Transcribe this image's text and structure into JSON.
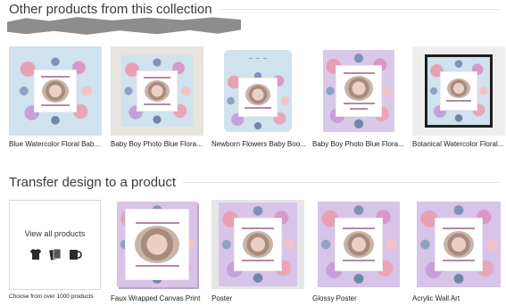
{
  "section1": {
    "title": "Other products from this collection"
  },
  "collection": [
    {
      "caption": "Blue Watercolor Floral Bab...",
      "bg": "#cfe2ee"
    },
    {
      "caption": "Baby Boy Photo Blue Flora...",
      "bg": "#e8e4df"
    },
    {
      "caption": "Newborn Flowers Baby Boo...",
      "bg": "#ffffff"
    },
    {
      "caption": "Baby Boy Photo Blue Flora...",
      "bg": "#ffffff"
    },
    {
      "caption": "Botanical Watercolor Floral...",
      "bg": "#eeeeee"
    }
  ],
  "section2": {
    "title": "Transfer design to a product"
  },
  "view_all": {
    "label": "View all products",
    "sub": "Choose from over 1000 products",
    "icons": [
      "tshirt-icon",
      "cards-icon",
      "mug-icon"
    ]
  },
  "transfer": [
    {
      "caption": "Faux Wrapped Canvas Print",
      "bg": "#ffffff"
    },
    {
      "caption": "Poster",
      "bg": "#e6e6e6"
    },
    {
      "caption": "Glossy Poster",
      "bg": "#ffffff"
    },
    {
      "caption": "Acrylic Wall Art",
      "bg": "#ffffff"
    }
  ],
  "colors": {
    "lavender": "#d7c4e8",
    "blue": "#cfe2ee",
    "rule": "#e2e2e2"
  }
}
